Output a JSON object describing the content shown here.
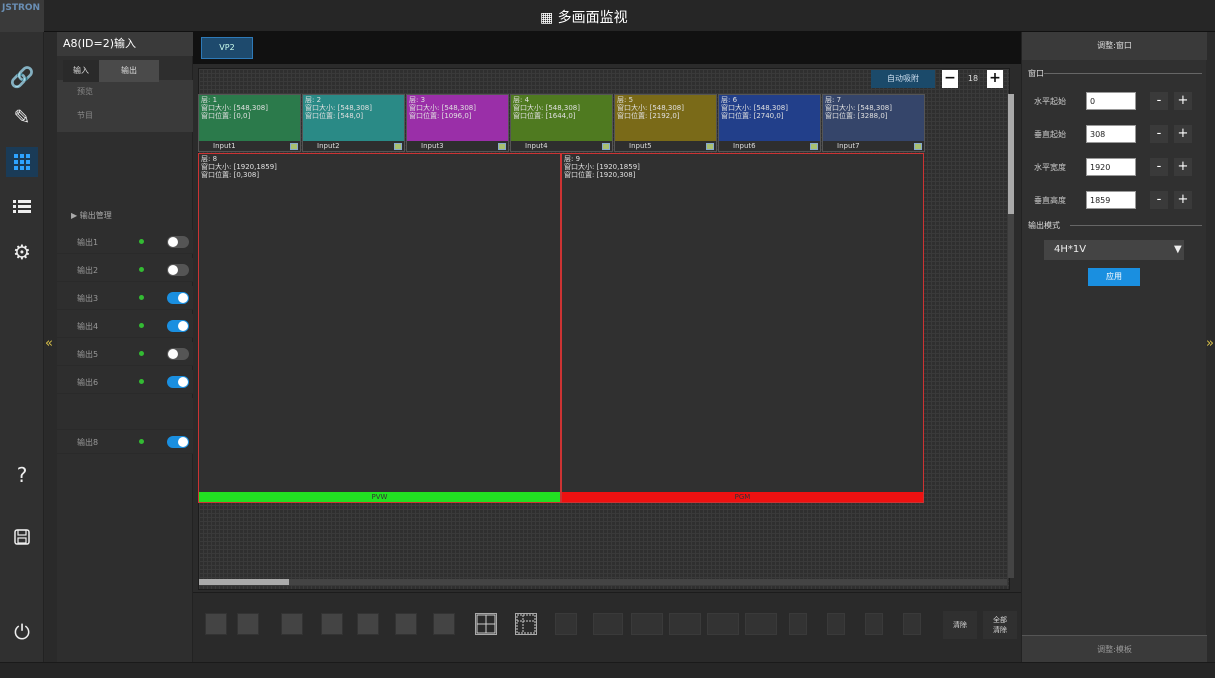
{
  "app": {
    "logo": "JSTRON",
    "title": "▦ 多画面监视"
  },
  "left_panel": {
    "title": "A8(ID=2)输入",
    "tabs": [
      "输入",
      "输出"
    ],
    "preview_label": "预览",
    "program_label": "节目",
    "output_mgmt_label": "▶ 输出管理",
    "outputs": [
      {
        "label": "输出1",
        "on": false
      },
      {
        "label": "输出2",
        "on": false
      },
      {
        "label": "输出3",
        "on": true
      },
      {
        "label": "输出4",
        "on": true
      },
      {
        "label": "输出5",
        "on": false
      },
      {
        "label": "输出6",
        "on": true
      },
      {
        "label": "输出8",
        "on": true
      }
    ]
  },
  "canvas": {
    "vp_tab": "VP2",
    "auto_snap": "自动吸附",
    "zoom": "18",
    "windows": [
      {
        "line1": "层: 1",
        "line2": "窗口大小: [548,308]",
        "line3": "窗口位置: [0,0]",
        "label": "Input1",
        "color": "#2b7a4b"
      },
      {
        "line1": "层: 2",
        "line2": "窗口大小: [548,308]",
        "line3": "窗口位置: [548,0]",
        "label": "Input2",
        "color": "#2a8a86"
      },
      {
        "line1": "层: 3",
        "line2": "窗口大小: [548,308]",
        "line3": "窗口位置: [1096,0]",
        "label": "Input3",
        "color": "#9a2fa8"
      },
      {
        "line1": "层: 4",
        "line2": "窗口大小: [548,308]",
        "line3": "窗口位置: [1644,0]",
        "label": "Input4",
        "color": "#4f7a20"
      },
      {
        "line1": "层: 5",
        "line2": "窗口大小: [548,308]",
        "line3": "窗口位置: [2192,0]",
        "label": "Input5",
        "color": "#7a6a18"
      },
      {
        "line1": "层: 6",
        "line2": "窗口大小: [548,308]",
        "line3": "窗口位置: [2740,0]",
        "label": "Input6",
        "color": "#223f8a"
      },
      {
        "line1": "层: 7",
        "line2": "窗口大小: [548,308]",
        "line3": "窗口位置: [3288,0]",
        "label": "Input7",
        "color": "#35456a"
      }
    ],
    "pvw": {
      "line1": "层: 8",
      "line2": "窗口大小: [1920,1859]",
      "line3": "窗口位置: [0,308]",
      "bar": "PVW",
      "bar_color": "#22e022"
    },
    "pgm": {
      "line1": "层: 9",
      "line2": "窗口大小: [1920,1859]",
      "line3": "窗口位置: [1920,308]",
      "bar": "PGM",
      "bar_color": "#ee1111"
    }
  },
  "bottom": {
    "clear": "清除",
    "clear_all": "全部\n清除"
  },
  "right_panel": {
    "header": "调整:窗口",
    "window_label": "窗口",
    "fields": [
      {
        "label": "水平起始",
        "value": "0"
      },
      {
        "label": "垂直起始",
        "value": "308"
      },
      {
        "label": "水平宽度",
        "value": "1920"
      },
      {
        "label": "垂直高度",
        "value": "1859"
      }
    ],
    "output_mode_label": "输出模式",
    "output_mode_value": "4H*1V",
    "apply": "应用",
    "footer": "调整:模板"
  }
}
